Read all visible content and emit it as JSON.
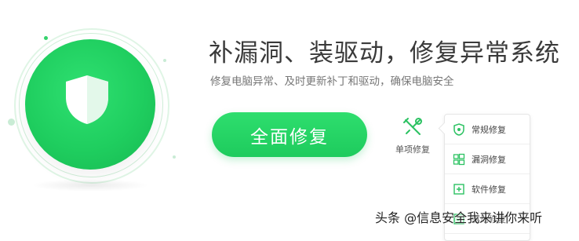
{
  "hero": {
    "headline": "补漏洞、装驱动，修复异常系统",
    "subline": "修复电脑异常、及时更新补丁和驱动，确保电脑安全"
  },
  "actions": {
    "fix_all_label": "全面修复",
    "single_fix_label": "单项修复"
  },
  "menu": {
    "items": [
      {
        "label": "常规修复",
        "icon": "shield-icon"
      },
      {
        "label": "漏洞修复",
        "icon": "windows-icon"
      },
      {
        "label": "软件修复",
        "icon": "plus-box-icon"
      },
      {
        "label": "驱动修复",
        "icon": "driver-icon"
      }
    ]
  },
  "watermark": "头条 @信息安全我来讲你来听",
  "colors": {
    "primary_green": "#22d163",
    "text_dark": "#3a3a3a",
    "text_muted": "#777777"
  }
}
